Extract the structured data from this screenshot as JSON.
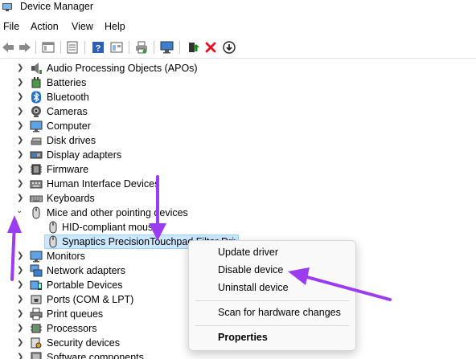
{
  "window": {
    "title": "Device Manager"
  },
  "menu": {
    "items": [
      "File",
      "Action",
      "View",
      "Help"
    ]
  },
  "toolbar": {
    "buttons": [
      "back-arrow-icon",
      "forward-arrow-icon",
      "show-hide-tree-icon",
      "properties-icon",
      "help-icon",
      "view-icon",
      "print-icon",
      "scan-hardware-icon",
      "update-driver-icon",
      "disable-device-icon",
      "uninstall-device-icon"
    ]
  },
  "tree": {
    "categories": [
      {
        "label": "Audio Processing Objects (APOs)",
        "icon": "speaker-icon",
        "expanded": false
      },
      {
        "label": "Batteries",
        "icon": "battery-icon",
        "expanded": false
      },
      {
        "label": "Bluetooth",
        "icon": "bluetooth-icon",
        "expanded": false
      },
      {
        "label": "Cameras",
        "icon": "camera-icon",
        "expanded": false
      },
      {
        "label": "Computer",
        "icon": "computer-icon",
        "expanded": false
      },
      {
        "label": "Disk drives",
        "icon": "disk-drive-icon",
        "expanded": false
      },
      {
        "label": "Display adapters",
        "icon": "display-adapter-icon",
        "expanded": false
      },
      {
        "label": "Firmware",
        "icon": "firmware-icon",
        "expanded": false
      },
      {
        "label": "Human Interface Devices",
        "icon": "hid-icon",
        "expanded": false
      },
      {
        "label": "Keyboards",
        "icon": "keyboard-icon",
        "expanded": false
      },
      {
        "label": "Mice and other pointing devices",
        "icon": "mouse-icon",
        "expanded": true
      },
      {
        "label": "Monitors",
        "icon": "monitor-icon",
        "expanded": false
      },
      {
        "label": "Network adapters",
        "icon": "network-icon",
        "expanded": false
      },
      {
        "label": "Portable Devices",
        "icon": "portable-device-icon",
        "expanded": false
      },
      {
        "label": "Ports (COM & LPT)",
        "icon": "port-icon",
        "expanded": false
      },
      {
        "label": "Print queues",
        "icon": "printer-icon",
        "expanded": false
      },
      {
        "label": "Processors",
        "icon": "processor-icon",
        "expanded": false
      },
      {
        "label": "Security devices",
        "icon": "security-icon",
        "expanded": false
      },
      {
        "label": "Software components",
        "icon": "software-icon",
        "expanded": false
      }
    ],
    "mice_children": [
      {
        "label": "HID-compliant mouse",
        "icon": "mouse-icon",
        "selected": false
      },
      {
        "label": "Synaptics PrecisionTouchpad Filter Driver",
        "icon": "mouse-icon",
        "selected": true
      }
    ]
  },
  "context_menu": {
    "items": [
      "Update driver",
      "Disable device",
      "Uninstall device",
      "Scan for hardware changes",
      "Properties"
    ]
  },
  "colors": {
    "annotation_arrow": "#9b3cf0",
    "selection": "#cce8ff",
    "delete_red": "#e81123",
    "update_green": "#0b8a0b"
  }
}
